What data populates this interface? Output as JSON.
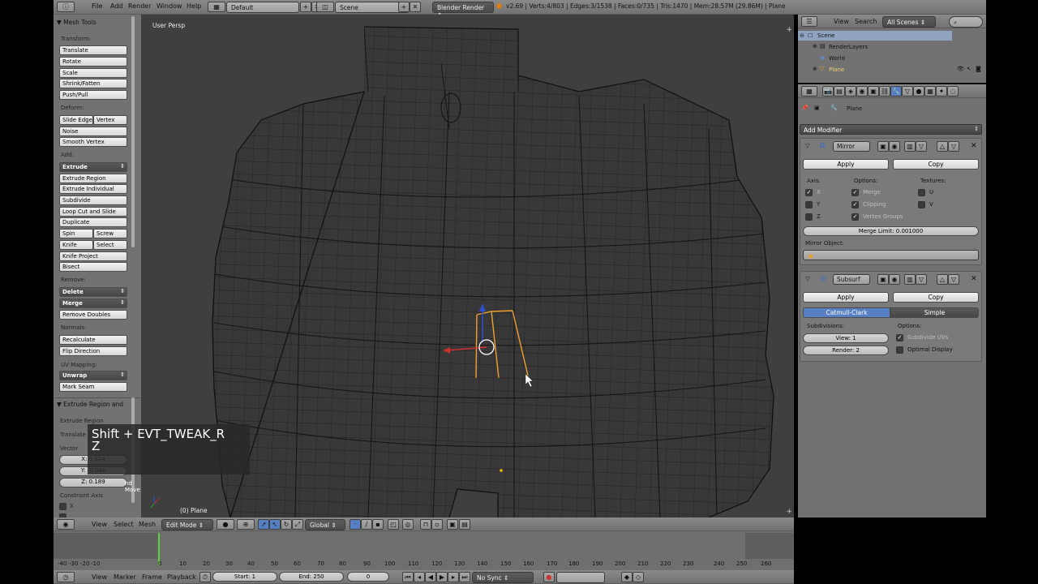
{
  "top_menu": {
    "items": [
      "File",
      "Add",
      "Render",
      "Window",
      "Help"
    ],
    "layout": "Default",
    "scene": "Scene",
    "engine": "Blender Render",
    "stats": "v2.69 | Verts:4/803 | Edges:3/1538 | Faces:0/735 | Tris:1470 | Mem:28.57M (29.86M) | Plane"
  },
  "tools": {
    "title": "Mesh Tools",
    "transform_label": "Transform:",
    "transform": [
      "Translate",
      "Rotate",
      "Scale",
      "Shrink/Fatten",
      "Push/Pull"
    ],
    "deform_label": "Deform:",
    "slide_edge": "Slide Edge",
    "vertex": "Vertex",
    "noise": "Noise",
    "smooth_vertex": "Smooth Vertex",
    "add_label": "Add:",
    "extrude": "Extrude",
    "extrude_region": "Extrude Region",
    "extrude_individual": "Extrude Individual",
    "subdivide": "Subdivide",
    "loop_cut": "Loop Cut and Slide",
    "duplicate": "Duplicate",
    "spin": "Spin",
    "screw": "Screw",
    "knife": "Knife",
    "select": "Select",
    "knife_project": "Knife Project",
    "bisect": "Bisect",
    "remove_label": "Remove:",
    "delete": "Delete",
    "merge": "Merge",
    "remove_doubles": "Remove Doubles",
    "normals_label": "Normals:",
    "recalculate": "Recalculate",
    "flip_direction": "Flip Direction",
    "uv_label": "UV Mapping:",
    "unwrap": "Unwrap",
    "mark_seam": "Mark Seam",
    "operator_title": "Extrude Region and",
    "operator_sub": "Extrude Region",
    "translate_label": "Translate",
    "vector_label": "Vector",
    "x_val": "X: 0.024",
    "y_val": "Y: -0.040",
    "z_val": "Z: 0.189",
    "move_label": "nd Move",
    "constraint_axis": "Constraint Axis",
    "cx": "X"
  },
  "viewport": {
    "view_label": "User Persp",
    "object_label": "(0) Plane",
    "screencast_line1": "Shift + EVT_TWEAK_R",
    "screencast_line2": "Z"
  },
  "view_header": {
    "view": "View",
    "select": "Select",
    "mesh": "Mesh",
    "mode": "Edit Mode",
    "orientation": "Global"
  },
  "outliner": {
    "view": "View",
    "search": "Search",
    "scenes": "All Scenes",
    "scene": "Scene",
    "renderlayers": "RenderLayers",
    "world": "World",
    "plane": "Plane"
  },
  "properties": {
    "breadcrumb": "Plane",
    "add_modifier": "Add Modifier",
    "mirror": {
      "name": "Mirror",
      "apply": "Apply",
      "copy": "Copy",
      "axis_label": "Axis:",
      "options_label": "Options:",
      "textures_label": "Textures:",
      "x": "X",
      "y": "Y",
      "z": "Z",
      "merge": "Merge",
      "clipping": "Clipping",
      "vertex_groups": "Vertex Groups",
      "u": "U",
      "v": "V",
      "merge_limit": "Merge Limit: 0.001000",
      "mirror_object": "Mirror Object:"
    },
    "subsurf": {
      "name": "Subsurf",
      "apply": "Apply",
      "copy": "Copy",
      "catmull": "Catmull-Clark",
      "simple": "Simple",
      "subdivisions_label": "Subdivisions:",
      "options_label": "Options:",
      "view": "View: 1",
      "render": "Render: 2",
      "subdivide_uvs": "Subdivide UVs",
      "optimal": "Optimal Display"
    }
  },
  "timeline": {
    "ticks": [
      "-40",
      "-30",
      "-20",
      "-10",
      "0",
      "10",
      "20",
      "30",
      "40",
      "50",
      "60",
      "70",
      "80",
      "90",
      "100",
      "110",
      "120",
      "130",
      "140",
      "150",
      "160",
      "170",
      "180",
      "190",
      "200",
      "210",
      "220",
      "230",
      "240",
      "250",
      "260"
    ],
    "view": "View",
    "marker": "Marker",
    "frame": "Frame",
    "playback": "Playback",
    "start": "Start: 1",
    "end": "End: 250",
    "current": "0",
    "sync": "No Sync"
  },
  "colors": {
    "selection": "#f0a030",
    "accent_blue": "#5680c2",
    "viewport_bg": "#3f3f3f",
    "panel_bg": "#727272"
  }
}
